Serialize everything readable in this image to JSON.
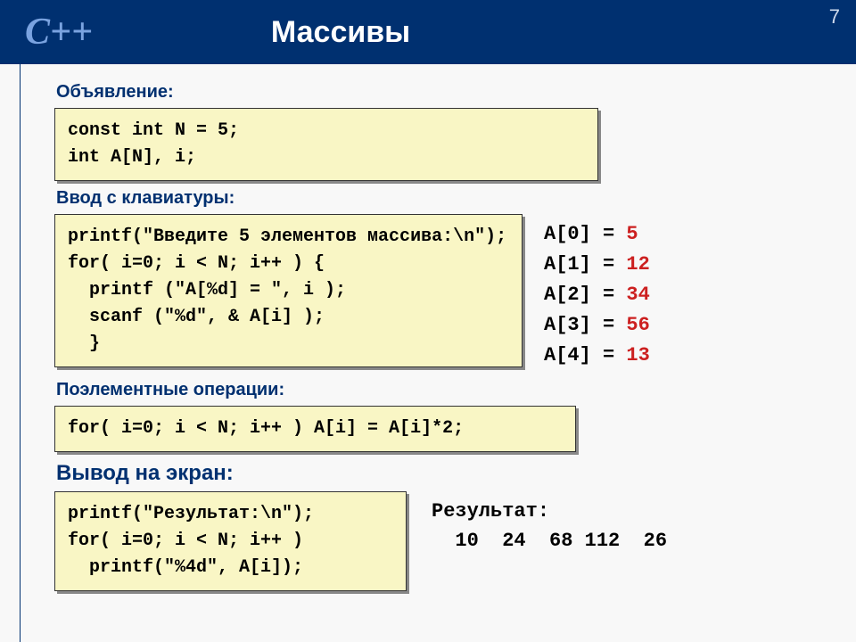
{
  "header": {
    "logo": "C++",
    "title": "Массивы",
    "page_number": "7"
  },
  "sections": {
    "declaration_label": "Объявление:",
    "declaration_code": "const int N = 5;\nint A[N], i;",
    "input_label": "Ввод с клавиатуры:",
    "input_code": "printf(\"Введите 5 элементов массива:\\n\");\nfor( i=0; i < N; i++ ) {\n  printf (\"A[%d] = \", i );\n  scanf (\"%d\", & A[i] );\n  }",
    "array_values": [
      {
        "label": "A[0] = ",
        "value": "5"
      },
      {
        "label": "A[1] = ",
        "value": "12"
      },
      {
        "label": "A[2] = ",
        "value": "34"
      },
      {
        "label": "A[3] = ",
        "value": "56"
      },
      {
        "label": "A[4] = ",
        "value": "13"
      }
    ],
    "ops_label": "Поэлементные операции:",
    "ops_code": "for( i=0; i < N; i++ ) A[i] = A[i]*2;",
    "output_label": "Вывод на экран:",
    "output_code": "printf(\"Результат:\\n\");\nfor( i=0; i < N; i++ )\n  printf(\"%4d\", A[i]);",
    "result_label": "Результат:",
    "result_values": "  10  24  68 112  26"
  }
}
